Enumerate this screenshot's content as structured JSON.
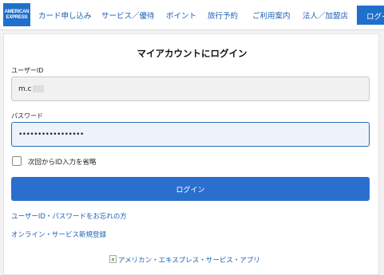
{
  "logo": {
    "line1": "AMERICAN",
    "line2": "EXPRESS"
  },
  "nav": {
    "items": [
      "カード申し込み",
      "サービス／優待",
      "ポイント",
      "旅行予約",
      "ご利用案内",
      "法人／加盟店"
    ],
    "login": "ログイン"
  },
  "form": {
    "title": "マイアカウントにログイン",
    "user_label": "ユーザーID",
    "user_value": "m.c",
    "password_label": "パスワード",
    "password_value": "•••••••••••••••••",
    "remember_label": "次回からID入力を省略",
    "remember_checked": false,
    "submit_label": "ログイン"
  },
  "links": {
    "forgot": "ユーザーID・パスワードをお忘れの方",
    "register": "オンライン・サービス新規登録",
    "app": "アメリカン・エキスプレス・サービス・アプリ"
  },
  "colors": {
    "brand": "#1f6fcc",
    "link": "#1d5fb5",
    "focus_border": "#2a6fb8"
  }
}
